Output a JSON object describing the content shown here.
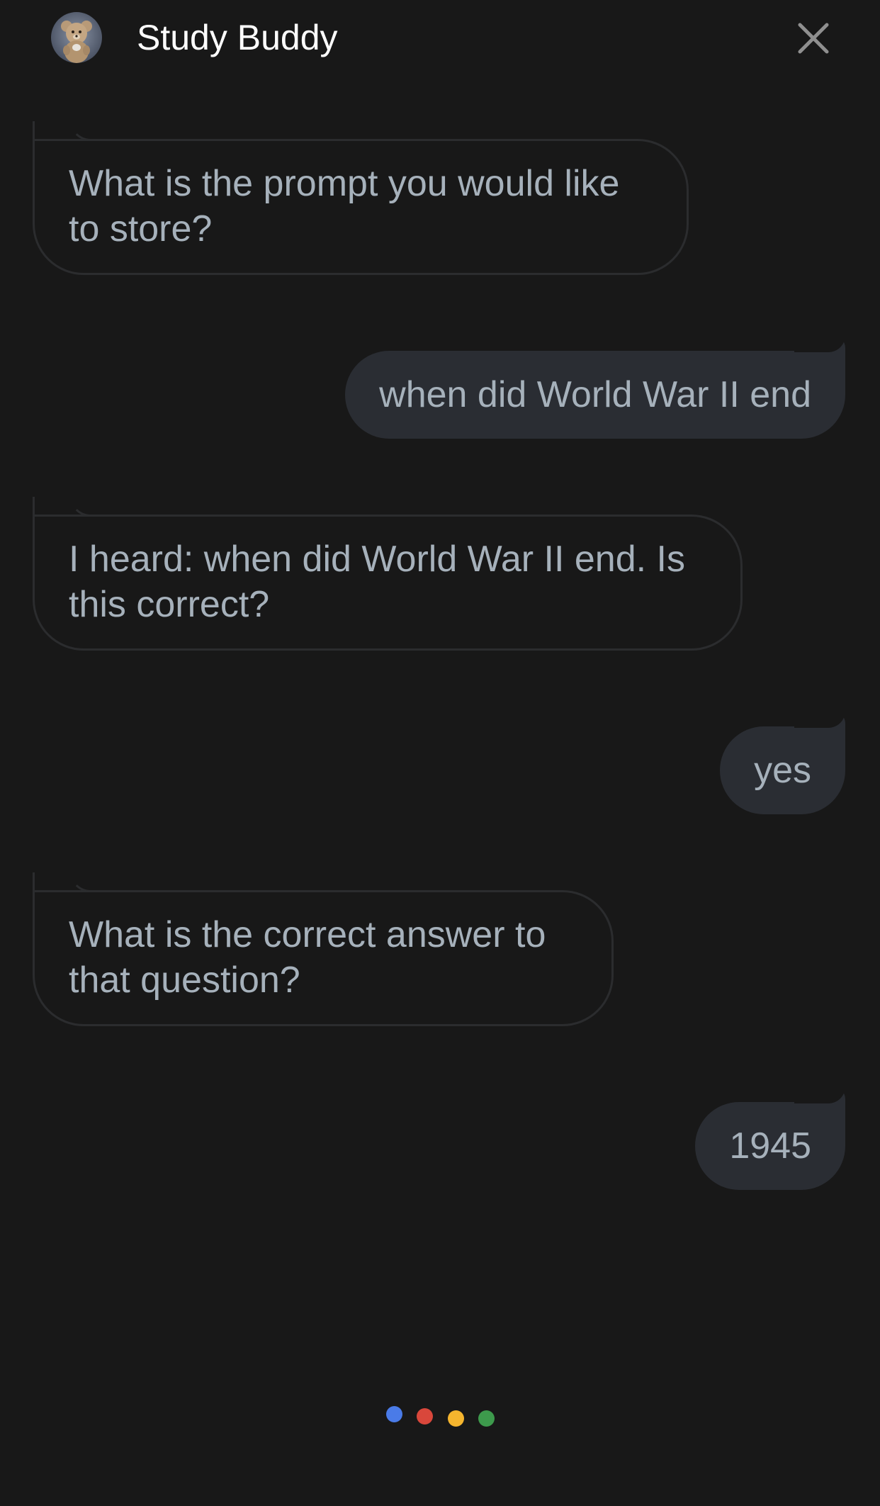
{
  "header": {
    "title": "Study Buddy",
    "avatar_icon": "teddy-bear-avatar",
    "close_icon": "close-icon"
  },
  "messages": [
    {
      "sender": "assistant",
      "text": "What is the prompt you would like to store?"
    },
    {
      "sender": "user",
      "text": "when did World War II end"
    },
    {
      "sender": "assistant",
      "text": "I heard: when did World War II end. Is this correct?"
    },
    {
      "sender": "user",
      "text": "yes"
    },
    {
      "sender": "assistant",
      "text": "What is the correct answer to that question?"
    },
    {
      "sender": "user",
      "text": "1945"
    }
  ],
  "listening_indicator": {
    "colors": [
      "#4a7be8",
      "#d9473b",
      "#f5b52e",
      "#3d9a4c"
    ]
  }
}
